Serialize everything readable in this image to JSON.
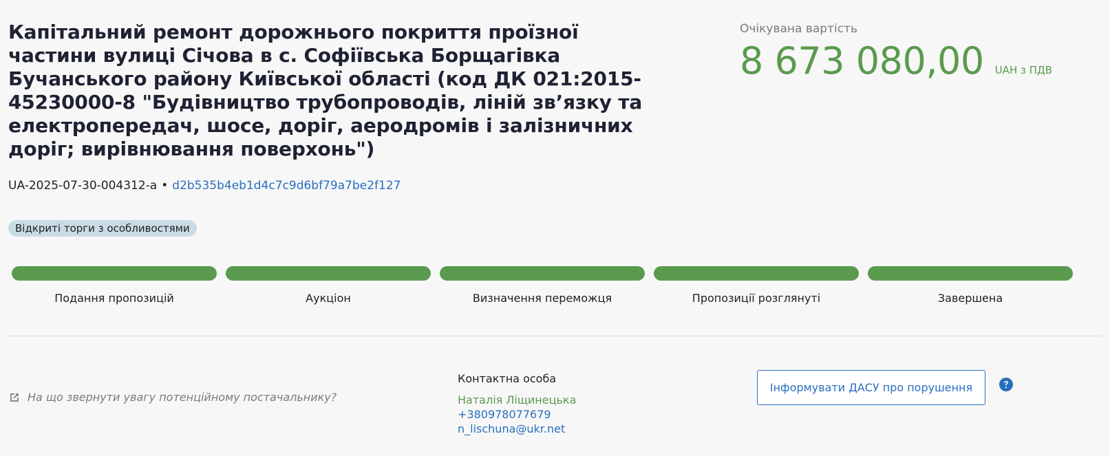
{
  "tender": {
    "title": "Капітальний ремонт дорожнього покриття проїзної частини вулиці Січова в с. Софіївська Борщагівка Бучанського району Київської області (код ДК 021:2015-45230000-8 \"Будівництво трубопроводів, ліній зв’язку та електропередач, шосе, доріг, аеродромів і залізничних доріг; вирівнювання поверхонь\")",
    "tender_id": "UA-2025-07-30-004312-a",
    "separator": "•",
    "hash": "d2b535b4eb1d4c7c9d6bf79a7be2f127",
    "procedure_badge": "Відкриті торги з особливостями"
  },
  "expected_value": {
    "label": "Очікувана вартість",
    "amount": "8 673 080,00",
    "currency": "UAH з ПДВ"
  },
  "stages": [
    {
      "label": "Подання пропозицій",
      "done": true
    },
    {
      "label": "Аукціон",
      "done": true
    },
    {
      "label": "Визначення переможця",
      "done": true
    },
    {
      "label": "Пропозиції розглянуті",
      "done": true
    },
    {
      "label": "Завершена",
      "done": true
    }
  ],
  "hint": {
    "text": "На що звернути увагу потенційному постачальнику?",
    "icon": "external-link-icon"
  },
  "contact": {
    "heading": "Контактна особа",
    "name": "Наталія Ліщинецька",
    "phone": "+380978077679",
    "email": "n_lischuna@ukr.net"
  },
  "actions": {
    "report_label": "Інформувати ДАСУ про порушення",
    "help_icon": "question-circle-icon"
  },
  "colors": {
    "accent_green": "#5a9a4e",
    "link_blue": "#2a6fbf",
    "badge_bg": "#c9dce6"
  }
}
